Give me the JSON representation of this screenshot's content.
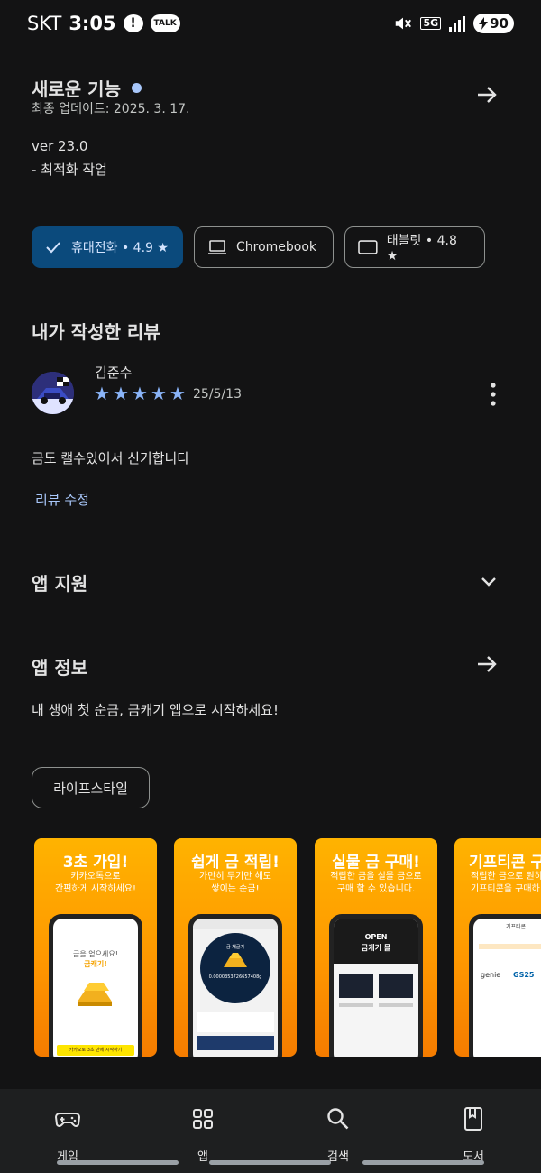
{
  "status_bar": {
    "carrier": "SKT",
    "time": "3:05",
    "talk_badge": "TALK",
    "network": "5G",
    "battery": "90"
  },
  "whats_new": {
    "title": "새로운 기능",
    "updated": "최종 업데이트: 2025. 3. 17.",
    "version": "ver 23.0",
    "notes": "- 최적화 작업"
  },
  "device_chips": [
    {
      "label": "휴대전화 • 4.9 ★",
      "selected": true,
      "icon": "check-icon"
    },
    {
      "label": "Chromebook",
      "selected": false,
      "icon": "laptop-icon"
    },
    {
      "label": "태블릿 • 4.8 ★",
      "selected": false,
      "icon": "tablet-icon"
    }
  ],
  "my_review": {
    "heading": "내가 작성한 리뷰",
    "reviewer": "김준수",
    "rating": 5,
    "date": "25/5/13",
    "text": "금도 캘수있어서 신기합니다",
    "edit_label": "리뷰 수정"
  },
  "app_support": {
    "title": "앱 지원"
  },
  "app_info": {
    "title": "앱 정보",
    "description": "내 생애 첫 순금, 금캐기 앱으로 시작하세요!",
    "category": "라이프스타일"
  },
  "screenshots": [
    {
      "title": "3초 가입!",
      "subtitle": "카카오톡으로\n간편하게 시작하세요!",
      "screen_text": "금을 얻으세요!",
      "screen_brand": "금캐기!",
      "screen_button": "카카오로 3초 만에 시작하기"
    },
    {
      "title": "쉽게 금 적립!",
      "subtitle": "가만히 두기만 해도\n쌓이는 순금!",
      "screen_value": "0.0000353726657408g",
      "screen_label": "금 채굴기"
    },
    {
      "title": "실물 금 구매!",
      "subtitle": "적립한 금을 실물 금으로\n구매 할 수 있습니다.",
      "screen_open": "OPEN",
      "screen_mall": "금캐기 몰"
    },
    {
      "title": "기프티콘 구",
      "subtitle": "적립한 금으로 원하\n기프티콘을 구매하",
      "screen_header": "기프티콘",
      "brand1": "genie",
      "brand2": "GS25"
    }
  ],
  "bottom_nav": [
    {
      "label": "게임",
      "icon": "gamepad-icon"
    },
    {
      "label": "앱",
      "icon": "apps-grid-icon"
    },
    {
      "label": "검색",
      "icon": "search-icon"
    },
    {
      "label": "도서",
      "icon": "book-icon"
    }
  ],
  "colors": {
    "background": "#131314",
    "accent": "#a8c7fa",
    "selected_chip": "#0b4a7c",
    "star": "#8ab4f8",
    "banner_orange": "#ff9800"
  }
}
